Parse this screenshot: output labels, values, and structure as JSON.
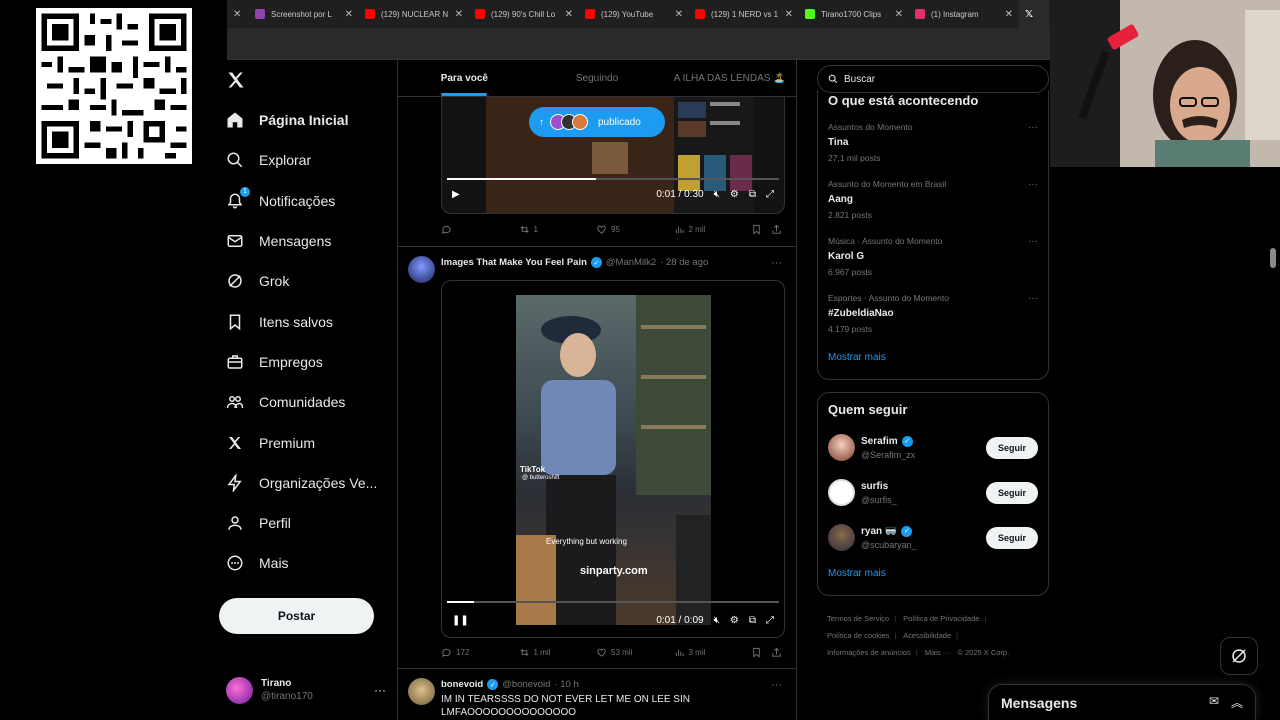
{
  "browser": {
    "tabs": [
      {
        "label": "Screenshot por L",
        "color": "#8e44ad"
      },
      {
        "label": "(129) NUCLEAR N",
        "color": "#ff0000"
      },
      {
        "label": "(129) 90's Chill Lo",
        "color": "#ff0000"
      },
      {
        "label": "(129) YouTube",
        "color": "#ff0000"
      },
      {
        "label": "(129) 1 NERD vs 1",
        "color": "#ff0000"
      },
      {
        "label": "Tirano1700 Clips",
        "color": "#53fc18"
      },
      {
        "label": "(1) Instagram",
        "color": "#e1306c"
      }
    ]
  },
  "nav": {
    "logo": "X",
    "items": [
      {
        "label": "Página Inicial",
        "icon": "home-icon",
        "active": true
      },
      {
        "label": "Explorar",
        "icon": "search-icon"
      },
      {
        "label": "Notificações",
        "icon": "bell-icon",
        "badge": "1"
      },
      {
        "label": "Mensagens",
        "icon": "mail-icon"
      },
      {
        "label": "Grok",
        "icon": "grok-icon"
      },
      {
        "label": "Itens salvos",
        "icon": "bookmark-icon"
      },
      {
        "label": "Empregos",
        "icon": "briefcase-icon"
      },
      {
        "label": "Comunidades",
        "icon": "people-icon"
      },
      {
        "label": "Premium",
        "icon": "x-icon"
      },
      {
        "label": "Organizações Ve...",
        "icon": "lightning-icon"
      },
      {
        "label": "Perfil",
        "icon": "person-icon"
      },
      {
        "label": "Mais",
        "icon": "more-circle-icon"
      }
    ],
    "post_label": "Postar",
    "account": {
      "name": "Tirano",
      "handle": "@tirano170",
      "more": "···"
    }
  },
  "feed": {
    "tabs": [
      "Para você",
      "Seguindo",
      "A ILHA DAS LENDAS 🏝️"
    ],
    "tweet1": {
      "pill_label": "publicado",
      "time": "0:01 / 0:30",
      "progress": 0.45,
      "stats": {
        "replies": "",
        "reposts": "1",
        "likes": "95",
        "views": "2 mil"
      }
    },
    "tweet2": {
      "name": "Images That Make You Feel Pain",
      "handle": "@ManMilk2",
      "date": "· 28 de ago",
      "overlay_tiktok": "TikTok",
      "overlay_user": "@ butteroshift",
      "overlay_caption": "Everything but working",
      "overlay_watermark": "sinparty.com",
      "time": "0:01 / 0:09",
      "progress": 0.08,
      "stats": {
        "replies": "172",
        "reposts": "1 mil",
        "likes": "53 mil",
        "views": "3 mil"
      }
    },
    "tweet3": {
      "name": "bonevoid",
      "handle": "@bonevoid",
      "date": "· 10 h",
      "text": "IM IN TEARSSSS DO NOT EVER LET ME ON LEE SIN LMFAOOOOOOOOOOOOOO"
    }
  },
  "right": {
    "search_placeholder": "Buscar",
    "trends_title": "O que está acontecendo",
    "trends": [
      {
        "context": "Assuntos do Momento",
        "title": "Tina",
        "posts": "27,1 mil posts"
      },
      {
        "context": "Assunto do Momento em Brasil",
        "title": "Aang",
        "posts": "2.821 posts"
      },
      {
        "context": "Música · Assunto do Momento",
        "title": "Karol G",
        "posts": "6.967 posts"
      },
      {
        "context": "Esportes · Assunto do Momento",
        "title": "#ZubeldiaNao",
        "posts": "4.179 posts"
      }
    ],
    "show_more": "Mostrar mais",
    "who_title": "Quem seguir",
    "who": [
      {
        "name": "Serafim",
        "handle": "@Serafim_zx",
        "verified": true,
        "follow": "Seguir"
      },
      {
        "name": "surfis",
        "handle": "@surfis_",
        "verified": false,
        "follow": "Seguir"
      },
      {
        "name": "ryan 🥽",
        "handle": "@scubaryan_",
        "verified": true,
        "follow": "Seguir"
      }
    ],
    "who_more": "Mostrar mais",
    "footer": [
      "Termos de Serviço",
      "Política de Privacidade",
      "Política de cookies",
      "Acessibilidade",
      "Informações de anúncios",
      "Mais ···",
      "© 2025 X Corp."
    ],
    "messages_title": "Mensagens"
  }
}
